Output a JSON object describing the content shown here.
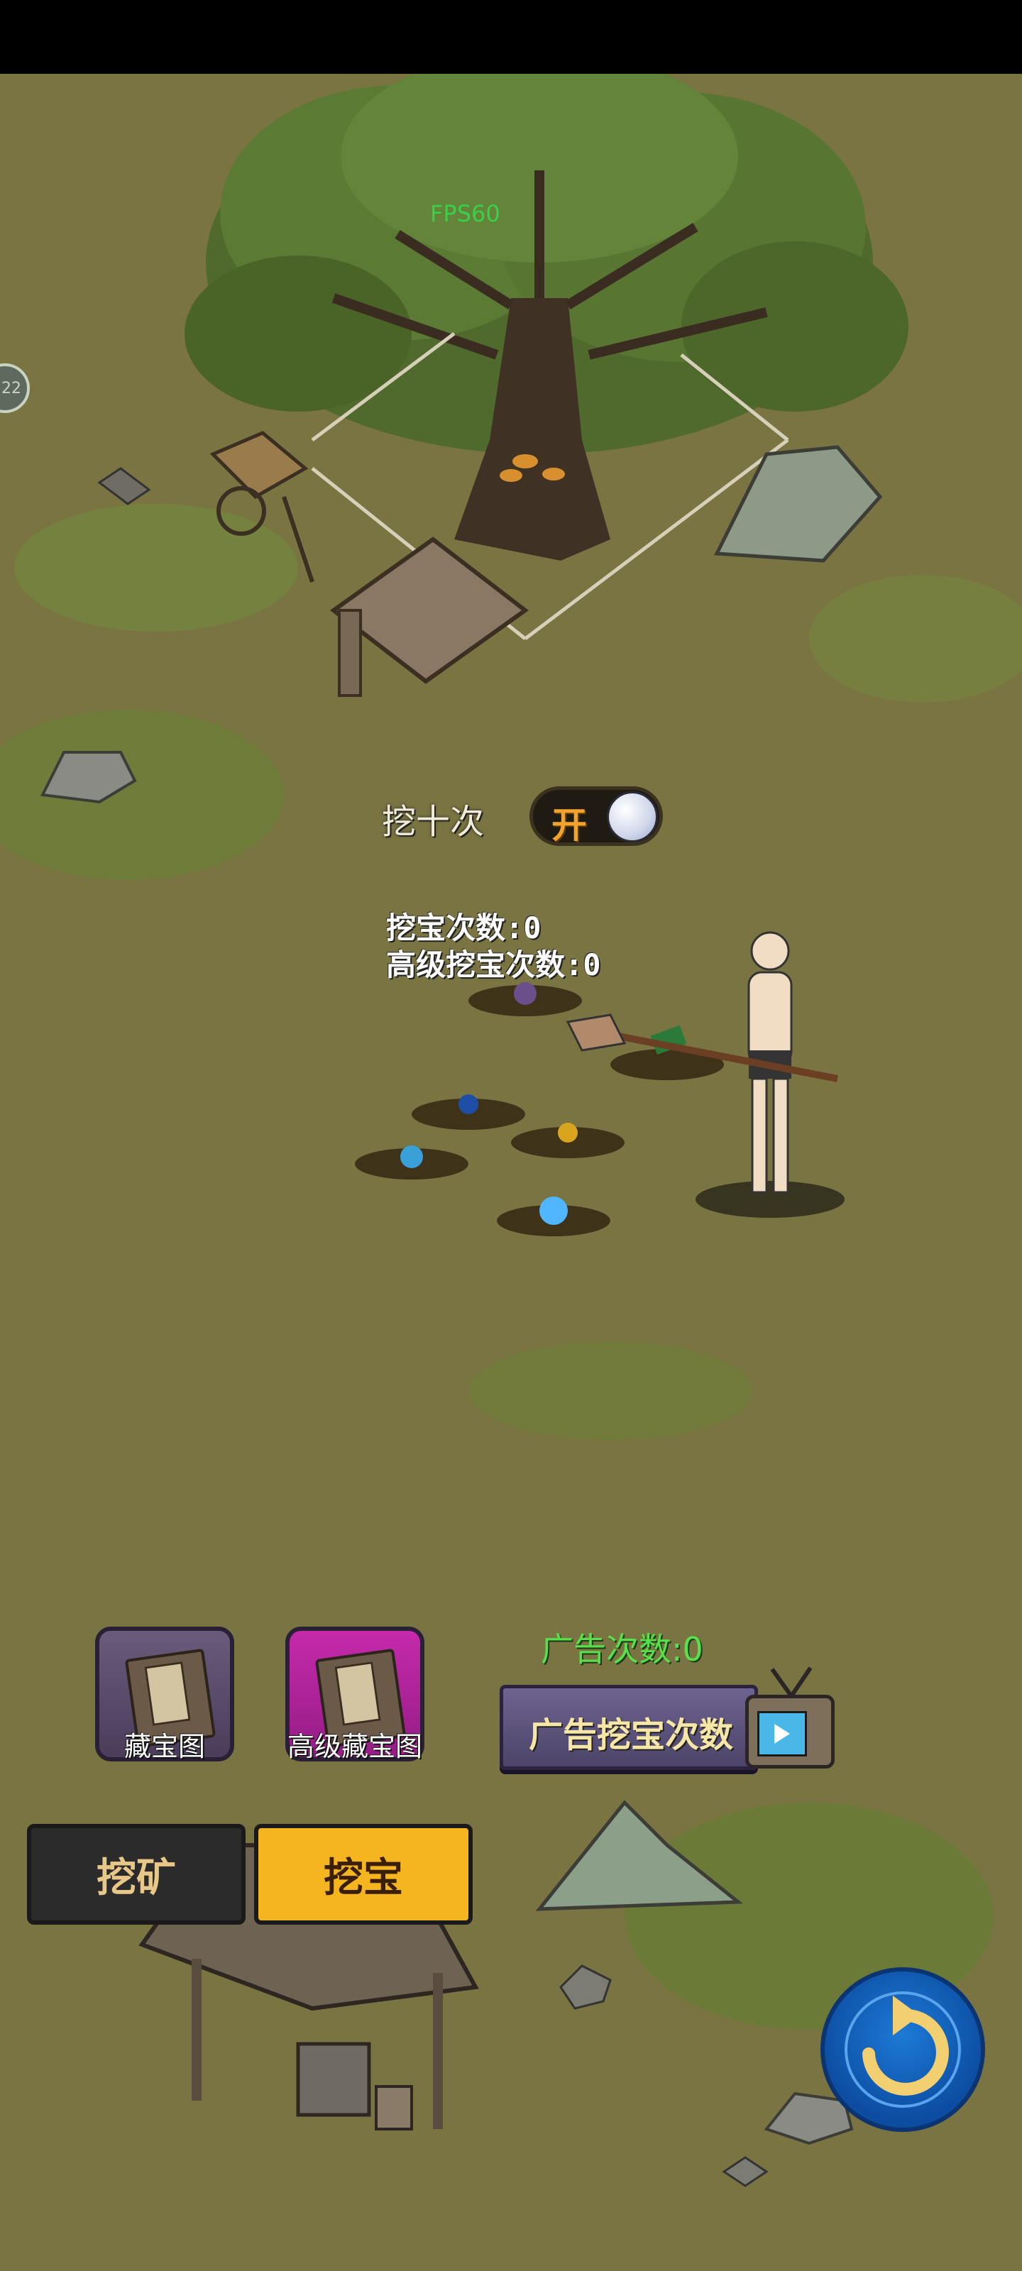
{
  "hud": {
    "fps": "FPS60",
    "side_badge": "22"
  },
  "dig_ten": {
    "label": "挖十次",
    "toggle_text": "开",
    "state": "on"
  },
  "stats": {
    "dig_count": "挖宝次数:0",
    "advanced_dig_count": "高级挖宝次数:0"
  },
  "items": [
    {
      "label": "藏宝图",
      "color": "#5b4a6c"
    },
    {
      "label": "高级藏宝图",
      "color": "#b3249c"
    }
  ],
  "ads": {
    "count_label": "广告次数:0",
    "button_label": "广告挖宝次数"
  },
  "tabs": {
    "mine": "挖矿",
    "treasure": "挖宝"
  },
  "colors": {
    "ground": "#7a7442",
    "tab_active": "#f5b51f",
    "tab_inactive": "#2b2b2b",
    "ad_count_green": "#57e04a"
  },
  "icons": {
    "ad_button": "tv-play-icon",
    "back_button": "return-arrow-icon"
  }
}
